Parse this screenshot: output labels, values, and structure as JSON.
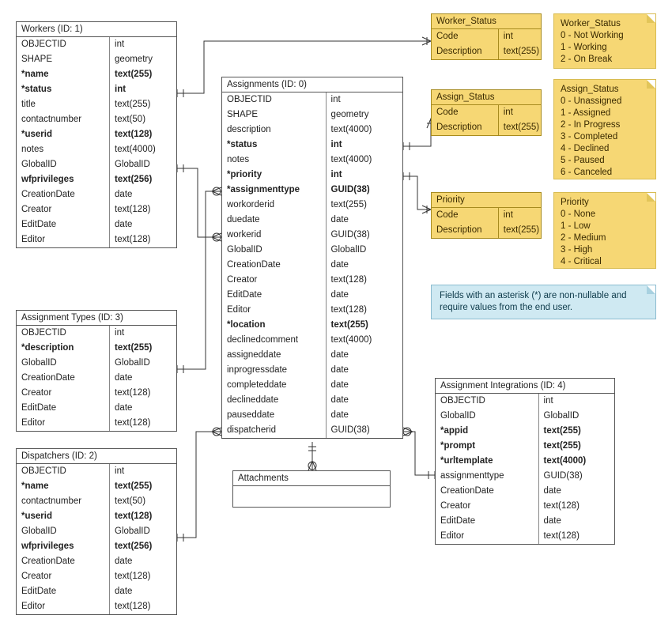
{
  "entities": {
    "workers": {
      "title": "Workers (ID: 1)",
      "fields": [
        {
          "name": "OBJECTID",
          "type": "int",
          "bold": false
        },
        {
          "name": "SHAPE",
          "type": "geometry",
          "bold": false
        },
        {
          "name": "*name",
          "type": "text(255)",
          "bold": true
        },
        {
          "name": "*status",
          "type": "int",
          "bold": true
        },
        {
          "name": "title",
          "type": "text(255)",
          "bold": false
        },
        {
          "name": "contactnumber",
          "type": "text(50)",
          "bold": false
        },
        {
          "name": "*userid",
          "type": "text(128)",
          "bold": true
        },
        {
          "name": "notes",
          "type": "text(4000)",
          "bold": false
        },
        {
          "name": "GlobalID",
          "type": "GlobalID",
          "bold": false
        },
        {
          "name": "wfprivileges",
          "type": "text(256)",
          "bold": true
        },
        {
          "name": "CreationDate",
          "type": "date",
          "bold": false
        },
        {
          "name": "Creator",
          "type": "text(128)",
          "bold": false
        },
        {
          "name": "EditDate",
          "type": "date",
          "bold": false
        },
        {
          "name": "Editor",
          "type": "text(128)",
          "bold": false
        }
      ]
    },
    "assignments": {
      "title": "Assignments (ID: 0)",
      "fields": [
        {
          "name": "OBJECTID",
          "type": "int",
          "bold": false
        },
        {
          "name": "SHAPE",
          "type": "geometry",
          "bold": false
        },
        {
          "name": "description",
          "type": "text(4000)",
          "bold": false
        },
        {
          "name": "*status",
          "type": "int",
          "bold": true
        },
        {
          "name": "notes",
          "type": "text(4000)",
          "bold": false
        },
        {
          "name": "*priority",
          "type": "int",
          "bold": true
        },
        {
          "name": "*assignmenttype",
          "type": "GUID(38)",
          "bold": true
        },
        {
          "name": "workorderid",
          "type": "text(255)",
          "bold": false
        },
        {
          "name": "duedate",
          "type": "date",
          "bold": false
        },
        {
          "name": "workerid",
          "type": "GUID(38)",
          "bold": false
        },
        {
          "name": "GlobalID",
          "type": "GlobalID",
          "bold": false
        },
        {
          "name": "CreationDate",
          "type": "date",
          "bold": false
        },
        {
          "name": "Creator",
          "type": "text(128)",
          "bold": false
        },
        {
          "name": "EditDate",
          "type": "date",
          "bold": false
        },
        {
          "name": "Editor",
          "type": "text(128)",
          "bold": false
        },
        {
          "name": "*location",
          "type": "text(255)",
          "bold": true
        },
        {
          "name": "declinedcomment",
          "type": "text(4000)",
          "bold": false
        },
        {
          "name": "assigneddate",
          "type": "date",
          "bold": false
        },
        {
          "name": "inprogressdate",
          "type": "date",
          "bold": false
        },
        {
          "name": "completeddate",
          "type": "date",
          "bold": false
        },
        {
          "name": "declineddate",
          "type": "date",
          "bold": false
        },
        {
          "name": "pauseddate",
          "type": "date",
          "bold": false
        },
        {
          "name": "dispatcherid",
          "type": "GUID(38)",
          "bold": false
        }
      ]
    },
    "assignment_types": {
      "title": "Assignment Types (ID: 3)",
      "fields": [
        {
          "name": "OBJECTID",
          "type": "int",
          "bold": false
        },
        {
          "name": "*description",
          "type": "text(255)",
          "bold": true
        },
        {
          "name": "GlobalID",
          "type": "GlobalID",
          "bold": false
        },
        {
          "name": "CreationDate",
          "type": "date",
          "bold": false
        },
        {
          "name": "Creator",
          "type": "text(128)",
          "bold": false
        },
        {
          "name": "EditDate",
          "type": "date",
          "bold": false
        },
        {
          "name": "Editor",
          "type": "text(128)",
          "bold": false
        }
      ]
    },
    "dispatchers": {
      "title": "Dispatchers (ID: 2)",
      "fields": [
        {
          "name": "OBJECTID",
          "type": "int",
          "bold": false
        },
        {
          "name": "*name",
          "type": "text(255)",
          "bold": true
        },
        {
          "name": "contactnumber",
          "type": "text(50)",
          "bold": false
        },
        {
          "name": "*userid",
          "type": "text(128)",
          "bold": true
        },
        {
          "name": "GlobalID",
          "type": "GlobalID",
          "bold": false
        },
        {
          "name": "wfprivileges",
          "type": "text(256)",
          "bold": true
        },
        {
          "name": "CreationDate",
          "type": "date",
          "bold": false
        },
        {
          "name": "Creator",
          "type": "text(128)",
          "bold": false
        },
        {
          "name": "EditDate",
          "type": "date",
          "bold": false
        },
        {
          "name": "Editor",
          "type": "text(128)",
          "bold": false
        }
      ]
    },
    "integrations": {
      "title": "Assignment Integrations (ID: 4)",
      "fields": [
        {
          "name": "OBJECTID",
          "type": "int",
          "bold": false
        },
        {
          "name": "GlobalID",
          "type": "GlobalID",
          "bold": false
        },
        {
          "name": "*appid",
          "type": "text(255)",
          "bold": true
        },
        {
          "name": "*prompt",
          "type": "text(255)",
          "bold": true
        },
        {
          "name": "*urltemplate",
          "type": "text(4000)",
          "bold": true
        },
        {
          "name": "assignmenttype",
          "type": "GUID(38)",
          "bold": false
        },
        {
          "name": "CreationDate",
          "type": "date",
          "bold": false
        },
        {
          "name": "Creator",
          "type": "text(128)",
          "bold": false
        },
        {
          "name": "EditDate",
          "type": "date",
          "bold": false
        },
        {
          "name": "Editor",
          "type": "text(128)",
          "bold": false
        }
      ]
    },
    "attachments": {
      "title": "Attachments"
    }
  },
  "lookups": {
    "worker_status": {
      "title": "Worker_Status",
      "fields": [
        {
          "name": "Code",
          "type": "int"
        },
        {
          "name": "Description",
          "type": "text(255)"
        }
      ]
    },
    "assign_status": {
      "title": "Assign_Status",
      "fields": [
        {
          "name": "Code",
          "type": "int"
        },
        {
          "name": "Description",
          "type": "text(255)"
        }
      ]
    },
    "priority": {
      "title": "Priority",
      "fields": [
        {
          "name": "Code",
          "type": "int"
        },
        {
          "name": "Description",
          "type": "text(255)"
        }
      ]
    }
  },
  "notes": {
    "worker_status": {
      "title": "Worker_Status",
      "lines": [
        "0 - Not Working",
        "1 - Working",
        "2 - On Break"
      ]
    },
    "assign_status": {
      "title": "Assign_Status",
      "lines": [
        "0 - Unassigned",
        "1 - Assigned",
        "2 - In Progress",
        "3 - Completed",
        "4 - Declined",
        "5 - Paused",
        "6 - Canceled"
      ]
    },
    "priority": {
      "title": "Priority",
      "lines": [
        "0 - None",
        "1 - Low",
        "2 - Medium",
        "3 - High",
        "4 - Critical"
      ]
    }
  },
  "info": {
    "text": "Fields with an asterisk (*) are non-nullable and require values from the end user."
  },
  "colors": {
    "note_bg": "#f6d774",
    "info_bg": "#cfe9f2",
    "line": "#333"
  }
}
